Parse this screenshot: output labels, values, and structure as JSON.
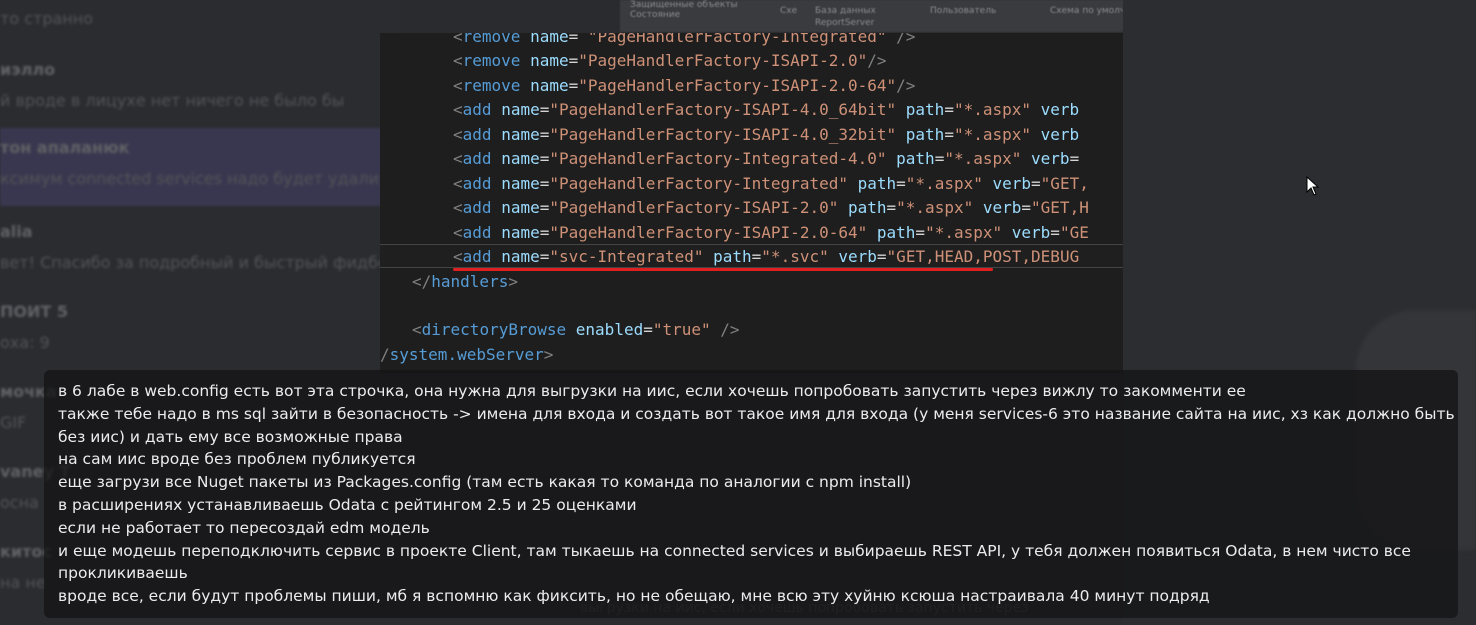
{
  "chat_list": [
    {
      "name": "",
      "snippet": "то странно"
    },
    {
      "name": "иэлло",
      "snippet": "й вроде в лицухе нет ничего не было бы"
    },
    {
      "name": "тон апаланюк",
      "snippet": "ксимум connected services надо будет удалить",
      "active": true
    },
    {
      "name": "alia",
      "snippet": "вет! Спасибо за подробный и быстрый фидбе"
    },
    {
      "name": "ПОИТ 5",
      "snippet": "оха: 9"
    },
    {
      "name": "мочка",
      "snippet": "GIF"
    },
    {
      "name": "vaney T",
      "snippet": "осна"
    },
    {
      "name": "китос",
      "snippet": "на не"
    }
  ],
  "top_strip": [
    "Защищенные объекты",
    "Состояние",
    "Схе",
    "База данных",
    "Пользователь",
    "Схема по умолчанию",
    "ReportServer"
  ],
  "code_lines": [
    [
      [
        "bracket",
        "<"
      ],
      [
        "tag",
        "remove"
      ],
      [
        "plain",
        " "
      ],
      [
        "attr",
        "name"
      ],
      [
        "eq",
        "= "
      ],
      [
        "str",
        "\"PageHandlerFactory-Integrated\""
      ],
      [
        "bracket",
        " />"
      ]
    ],
    [
      [
        "bracket",
        "<"
      ],
      [
        "tag",
        "remove"
      ],
      [
        "plain",
        " "
      ],
      [
        "attr",
        "name"
      ],
      [
        "eq",
        "="
      ],
      [
        "str",
        "\"PageHandlerFactory-ISAPI-2.0\""
      ],
      [
        "bracket",
        "/>"
      ]
    ],
    [
      [
        "bracket",
        "<"
      ],
      [
        "tag",
        "remove"
      ],
      [
        "plain",
        " "
      ],
      [
        "attr",
        "name"
      ],
      [
        "eq",
        "="
      ],
      [
        "str",
        "\"PageHandlerFactory-ISAPI-2.0-64\""
      ],
      [
        "bracket",
        "/>"
      ]
    ],
    [
      [
        "bracket",
        "<"
      ],
      [
        "tag",
        "add"
      ],
      [
        "plain",
        " "
      ],
      [
        "attr",
        "name"
      ],
      [
        "eq",
        "="
      ],
      [
        "str",
        "\"PageHandlerFactory-ISAPI-4.0_64bit\""
      ],
      [
        "plain",
        " "
      ],
      [
        "attr",
        "path"
      ],
      [
        "eq",
        "="
      ],
      [
        "str",
        "\"*.aspx\""
      ],
      [
        "plain",
        " "
      ],
      [
        "attr",
        "verb"
      ]
    ],
    [
      [
        "bracket",
        "<"
      ],
      [
        "tag",
        "add"
      ],
      [
        "plain",
        " "
      ],
      [
        "attr",
        "name"
      ],
      [
        "eq",
        "="
      ],
      [
        "str",
        "\"PageHandlerFactory-ISAPI-4.0_32bit\""
      ],
      [
        "plain",
        " "
      ],
      [
        "attr",
        "path"
      ],
      [
        "eq",
        "="
      ],
      [
        "str",
        "\"*.aspx\""
      ],
      [
        "plain",
        " "
      ],
      [
        "attr",
        "verb"
      ]
    ],
    [
      [
        "bracket",
        "<"
      ],
      [
        "tag",
        "add"
      ],
      [
        "plain",
        " "
      ],
      [
        "attr",
        "name"
      ],
      [
        "eq",
        "="
      ],
      [
        "str",
        "\"PageHandlerFactory-Integrated-4.0\""
      ],
      [
        "plain",
        " "
      ],
      [
        "attr",
        "path"
      ],
      [
        "eq",
        "="
      ],
      [
        "str",
        "\"*.aspx\""
      ],
      [
        "plain",
        " "
      ],
      [
        "attr",
        "verb"
      ],
      [
        "eq",
        "="
      ]
    ],
    [
      [
        "bracket",
        "<"
      ],
      [
        "tag",
        "add"
      ],
      [
        "plain",
        " "
      ],
      [
        "attr",
        "name"
      ],
      [
        "eq",
        "="
      ],
      [
        "str",
        "\"PageHandlerFactory-Integrated\""
      ],
      [
        "plain",
        " "
      ],
      [
        "attr",
        "path"
      ],
      [
        "eq",
        "="
      ],
      [
        "str",
        "\"*.aspx\""
      ],
      [
        "plain",
        " "
      ],
      [
        "attr",
        "verb"
      ],
      [
        "eq",
        "="
      ],
      [
        "str",
        "\"GET,"
      ]
    ],
    [
      [
        "bracket",
        "<"
      ],
      [
        "tag",
        "add"
      ],
      [
        "plain",
        " "
      ],
      [
        "attr",
        "name"
      ],
      [
        "eq",
        "="
      ],
      [
        "str",
        "\"PageHandlerFactory-ISAPI-2.0\""
      ],
      [
        "plain",
        " "
      ],
      [
        "attr",
        "path"
      ],
      [
        "eq",
        "="
      ],
      [
        "str",
        "\"*.aspx\""
      ],
      [
        "plain",
        " "
      ],
      [
        "attr",
        "verb"
      ],
      [
        "eq",
        "="
      ],
      [
        "str",
        "\"GET,H"
      ]
    ],
    [
      [
        "bracket",
        "<"
      ],
      [
        "tag",
        "add"
      ],
      [
        "plain",
        " "
      ],
      [
        "attr",
        "name"
      ],
      [
        "eq",
        "="
      ],
      [
        "str",
        "\"PageHandlerFactory-ISAPI-2.0-64\""
      ],
      [
        "plain",
        " "
      ],
      [
        "attr",
        "path"
      ],
      [
        "eq",
        "="
      ],
      [
        "str",
        "\"*.aspx\""
      ],
      [
        "plain",
        " "
      ],
      [
        "attr",
        "verb"
      ],
      [
        "eq",
        "="
      ],
      [
        "str",
        "\"GE"
      ]
    ],
    [
      [
        "bracket",
        "<"
      ],
      [
        "tag",
        "add"
      ],
      [
        "plain",
        " "
      ],
      [
        "attr",
        "name"
      ],
      [
        "eq",
        "="
      ],
      [
        "str",
        "\"svc-Integrated\""
      ],
      [
        "plain",
        " "
      ],
      [
        "attr",
        "path"
      ],
      [
        "eq",
        "="
      ],
      [
        "str",
        "\"*.svc\""
      ],
      [
        "plain",
        " "
      ],
      [
        "attr",
        "verb"
      ],
      [
        "eq",
        "="
      ],
      [
        "str",
        "\"GET,HEAD,POST,DEBUG"
      ]
    ],
    [
      [
        "bracket",
        "</"
      ],
      [
        "tag",
        "handlers"
      ],
      [
        "bracket",
        ">"
      ]
    ],
    [],
    [
      [
        "bracket",
        "<"
      ],
      [
        "tag",
        "directoryBrowse"
      ],
      [
        "plain",
        " "
      ],
      [
        "attr",
        "enabled"
      ],
      [
        "eq",
        "="
      ],
      [
        "str",
        "\"true\""
      ],
      [
        "bracket",
        " />"
      ]
    ],
    [
      [
        "bracket",
        "/"
      ],
      [
        "tag",
        "system.webServer"
      ],
      [
        "bracket",
        ">"
      ]
    ]
  ],
  "message_lines": [
    "в 6 лабе в web.config есть вот эта строчка, она нужна для выгрузки на иис, если хочешь попробовать запустить через вижлу то закомменти ее",
    "также тебе надо в ms sql зайти в безопасность -> имена для входа и создать вот такое имя для входа (у меня services-6 это название сайта на иис, хз как должно быть",
    "без иис) и дать ему все возможные права",
    "на сам иис вроде без проблем публикуется",
    "еще загрузи все Nuget пакеты из Packages.config (там есть какая то команда по аналогии с npm install)",
    "в расширениях устанавливаешь Odata с рейтингом 2.5 и 25 оценками",
    "если не работает то пересоздай edm модель",
    "и еще модешь переподключить сервис в проекте Client, там тыкаешь на connected services и выбираешь REST API, у тебя должен появиться Odata, в нем чисто все",
    "прокликиваешь",
    "вроде все, если будут проблемы пиши, мб я вспомню как фиксить, но не обещаю, мне всю эту хуйню ксюша настраивала 40 минут подряд"
  ],
  "bottom_text": "выгрузки на иис, если хочешь попробовать запустить через"
}
